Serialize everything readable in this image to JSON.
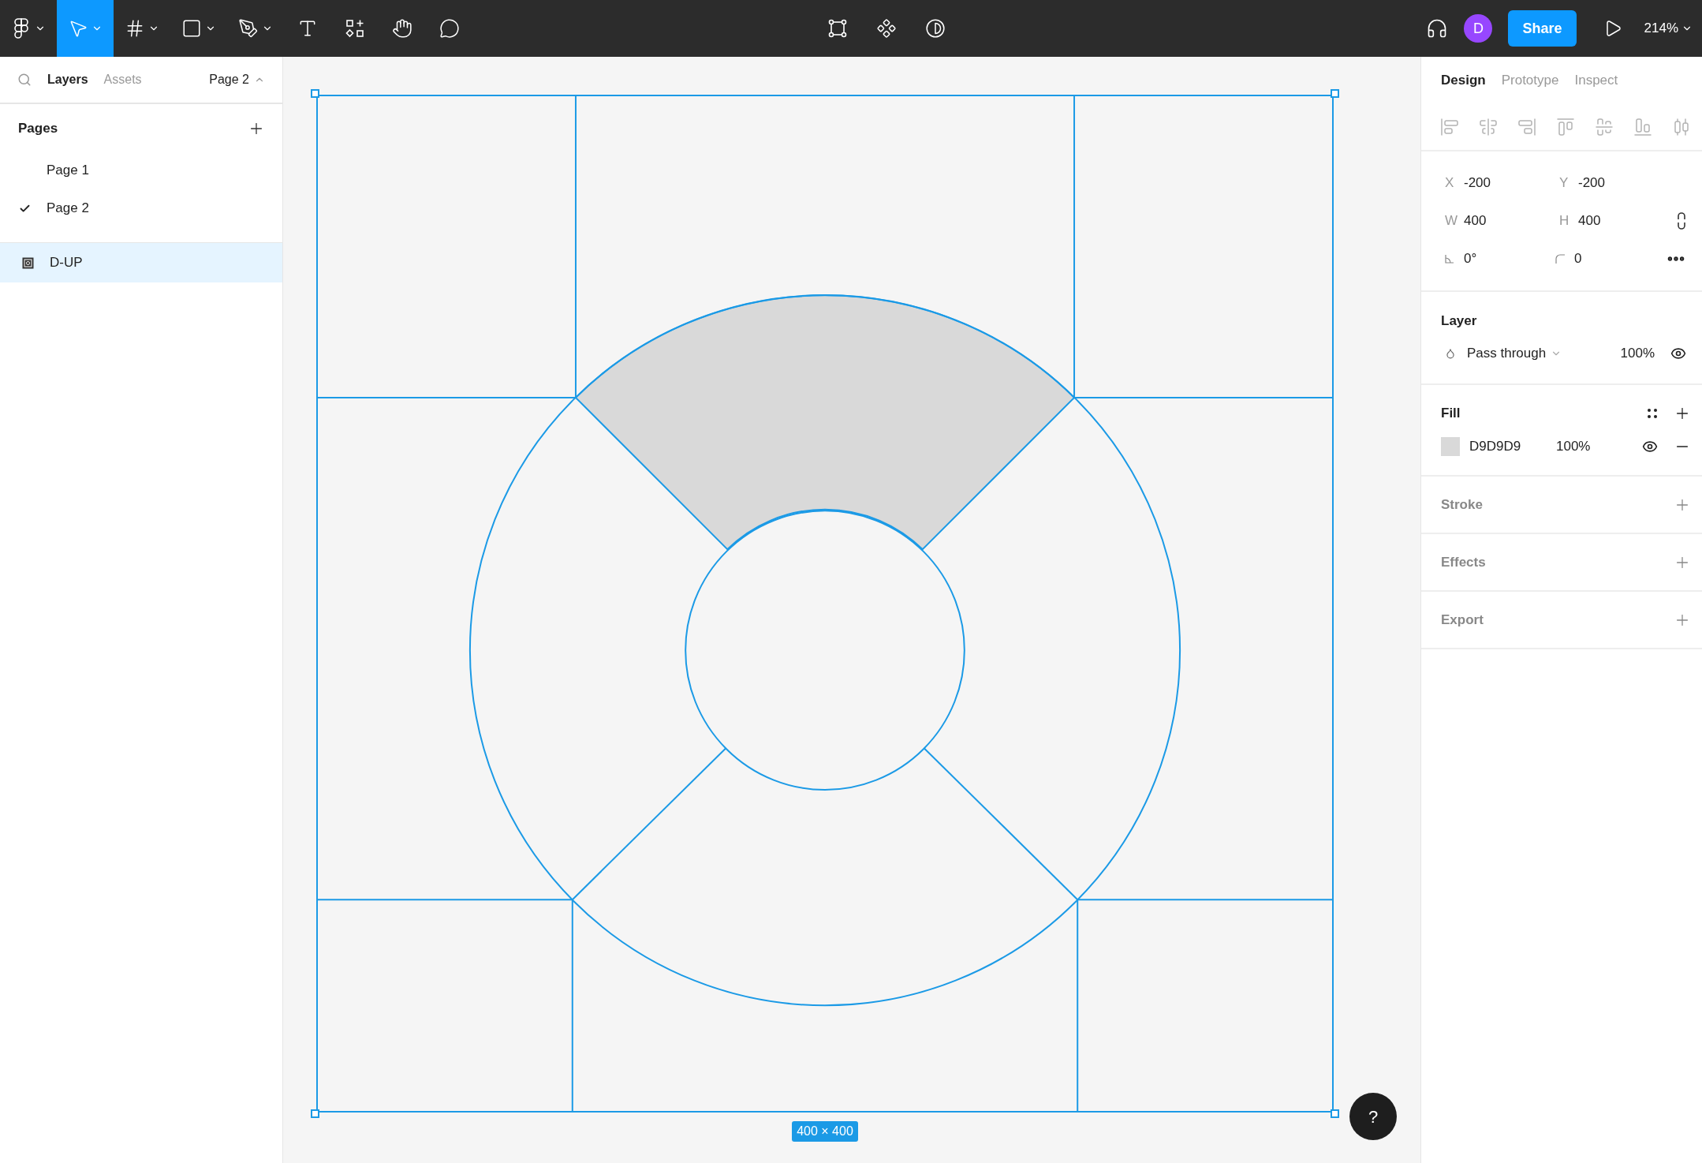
{
  "toolbar": {
    "tools": [
      {
        "kind": "logo",
        "selected": false,
        "dropdown": true
      },
      {
        "kind": "move",
        "selected": true,
        "dropdown": true
      },
      {
        "kind": "frame",
        "selected": false,
        "dropdown": true
      },
      {
        "kind": "rectangle",
        "selected": false,
        "dropdown": true
      },
      {
        "kind": "pen",
        "selected": false,
        "dropdown": true
      },
      {
        "kind": "text",
        "selected": false,
        "dropdown": false
      },
      {
        "kind": "resources",
        "selected": false,
        "dropdown": false
      },
      {
        "kind": "hand",
        "selected": false,
        "dropdown": false
      },
      {
        "kind": "comment",
        "selected": false,
        "dropdown": false
      }
    ],
    "center_tools": [
      {
        "kind": "edit-object"
      },
      {
        "kind": "component"
      },
      {
        "kind": "mask"
      }
    ],
    "avatar": "D",
    "share": "Share",
    "zoom": "214%"
  },
  "left_panel": {
    "tabs": [
      {
        "label": "Layers",
        "selected": true
      },
      {
        "label": "Assets",
        "selected": false
      }
    ],
    "page_menu": "Page 2",
    "pages_title": "Pages",
    "pages": [
      {
        "name": "Page 1",
        "selected": false
      },
      {
        "name": "Page 2",
        "selected": true
      }
    ],
    "layers": [
      {
        "name": "D-UP",
        "selected": true
      }
    ]
  },
  "canvas": {
    "size_label": "400 × 400"
  },
  "right_panel": {
    "tabs": [
      {
        "label": "Design",
        "selected": true
      },
      {
        "label": "Prototype",
        "selected": false
      },
      {
        "label": "Inspect",
        "selected": false
      }
    ],
    "properties": [
      {
        "kind": "letter",
        "label": "X",
        "value": "-200"
      },
      {
        "kind": "letter",
        "label": "Y",
        "value": "-200"
      },
      {
        "kind": "letter",
        "label": "W",
        "value": "400"
      },
      {
        "kind": "letter",
        "label": "H",
        "value": "400"
      },
      {
        "kind": "rotation",
        "value": "0°"
      },
      {
        "kind": "corner-radius",
        "value": "0"
      }
    ],
    "layer": {
      "title": "Layer",
      "blend": "Pass through",
      "opacity": "100%",
      "visible": true
    },
    "fill": {
      "title": "Fill",
      "hex": "D9D9D9",
      "opacity": "100%",
      "visible": true
    },
    "sections": [
      "Stroke",
      "Effects",
      "Export"
    ]
  },
  "help_button": "?"
}
